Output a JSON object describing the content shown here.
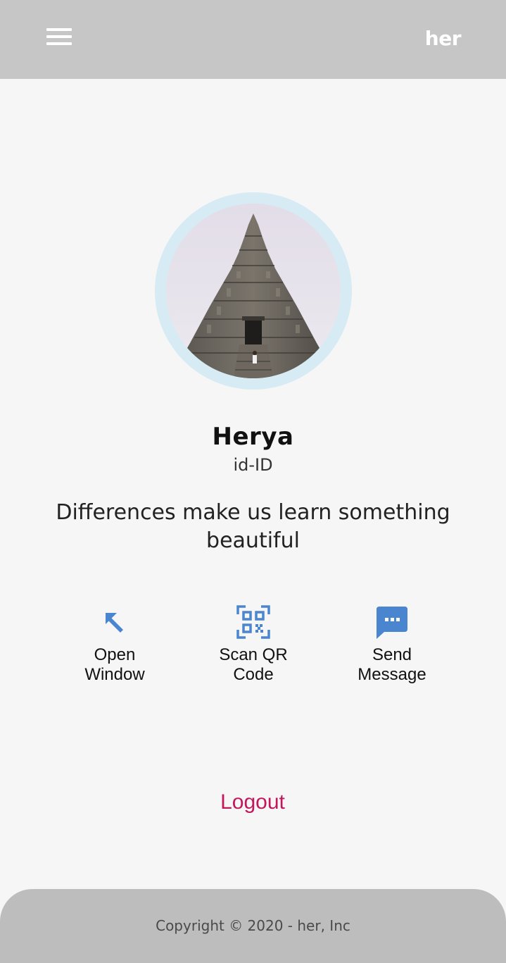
{
  "header": {
    "menu_icon": "menu-icon",
    "brand": "her",
    "background": "#c6c6c6"
  },
  "profile": {
    "name": "Herya",
    "locale": "id-ID",
    "bio": "Differences make us learn something beautiful",
    "avatar_ring_color": "#d6ebf3"
  },
  "actions": [
    {
      "label_line1": "Open",
      "label_line2": "Window",
      "icon": "arrow-up-left-icon"
    },
    {
      "label_line1": "Scan QR",
      "label_line2": "Code",
      "icon": "qr-code-scan-icon"
    },
    {
      "label_line1": "Send",
      "label_line2": "Message",
      "icon": "message-bubble-icon"
    }
  ],
  "accent_color": "#4a86cf",
  "logout": {
    "label": "Logout",
    "color": "#c2185b"
  },
  "footer": {
    "copyright": "Copyright © 2020 - her, Inc"
  }
}
